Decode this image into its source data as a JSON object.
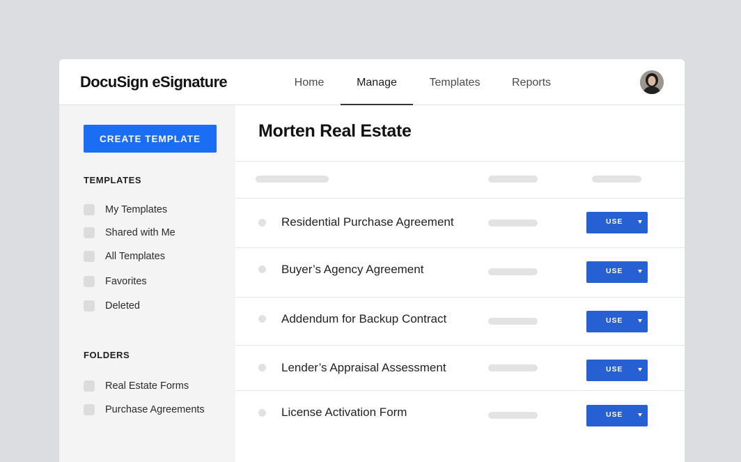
{
  "app": {
    "logo_text": "DocuSign eSignature"
  },
  "nav": {
    "items": [
      {
        "label": "Home"
      },
      {
        "label": "Manage"
      },
      {
        "label": "Templates"
      },
      {
        "label": "Reports"
      }
    ],
    "active": "Manage"
  },
  "sidebar": {
    "create_button_label": "CREATE TEMPLATE",
    "templates_heading": "TEMPLATES",
    "template_items": [
      {
        "label": "My Templates"
      },
      {
        "label": "Shared with Me"
      },
      {
        "label": "All Templates"
      },
      {
        "label": "Favorites"
      },
      {
        "label": "Deleted"
      }
    ],
    "folders_heading": "FOLDERS",
    "folder_items": [
      {
        "label": "Real Estate Forms"
      },
      {
        "label": "Purchase Agreements"
      }
    ]
  },
  "main": {
    "title": "Morten Real Estate",
    "rows": [
      {
        "name": "Residential Purchase Agreement",
        "action_label": "USE"
      },
      {
        "name": "Buyer’s Agency Agreement",
        "action_label": "USE"
      },
      {
        "name": "Addendum for Backup Contract",
        "action_label": "USE"
      },
      {
        "name": "Lender’s Appraisal Assessment",
        "action_label": "USE"
      },
      {
        "name": "License Activation Form",
        "action_label": "USE"
      }
    ]
  },
  "colors": {
    "page_bg": "#dcdde1",
    "primary_button": "#1b6ef3",
    "use_button": "#2760d3",
    "sidebar_bg": "#f4f4f4"
  },
  "icons": {
    "avatar": "user-avatar",
    "dropdown": "caret-down-icon",
    "checkbox": "checkbox-empty-icon"
  }
}
